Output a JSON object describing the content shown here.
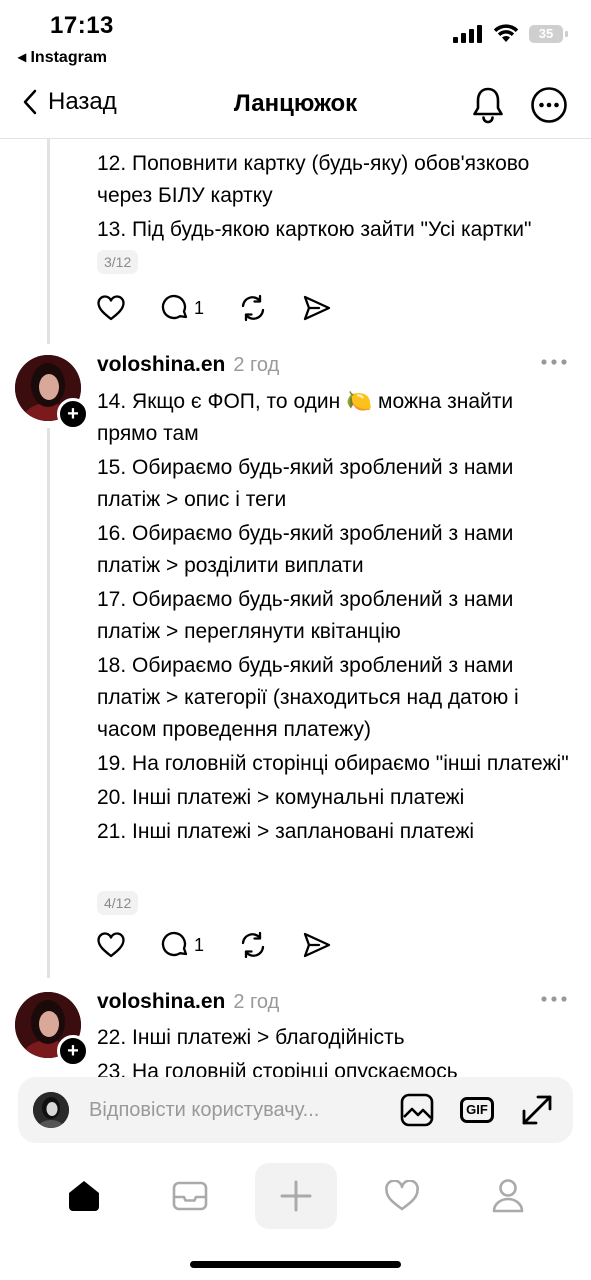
{
  "status_bar": {
    "time": "17:13",
    "back_app": "◂ Instagram",
    "battery": "35"
  },
  "nav": {
    "back_label": "Назад",
    "title": "Ланцюжок"
  },
  "posts": [
    {
      "lines": [
        "12. Поповнити картку (будь-яку) обов'язково через БІЛУ картку",
        "13. Під будь-якою карткою зайти \"Усі картки\""
      ],
      "page_badge": "3/12",
      "reply_count": "1"
    },
    {
      "username": "voloshina.en",
      "time": "2 год",
      "lines": [
        "14. Якщо є ФОП, то один 🍋 можна знайти прямо там",
        "15. Обираємо будь-який зроблений з нами платіж > опис і теги",
        "16. Обираємо будь-який зроблений з нами платіж > розділити виплати",
        "17. Обираємо будь-який зроблений з нами платіж > переглянути квітанцію",
        "18. Обираємо будь-який зроблений з нами платіж > категорії (знаходиться над датою і часом проведення платежу)",
        "19. На головній сторінці обираємо \"інші платежі\"",
        "20. Інші платежі > комунальні платежі",
        "21. Інші платежі > заплановані платежі"
      ],
      "page_badge": "4/12",
      "reply_count": "1"
    },
    {
      "username": "voloshina.en",
      "time": "2 год",
      "lines": [
        "22. Інші платежі > благодійність",
        "23. На головній сторінці опускаємось"
      ]
    }
  ],
  "reply_bar": {
    "placeholder": "Відповісти користувачу..."
  },
  "tabs": [
    "home-icon",
    "inbox-icon",
    "create-icon",
    "activity-icon",
    "profile-icon"
  ],
  "colors": {
    "avatar_bg": "#3b0d0f",
    "muted": "#999999",
    "divider": "#e3e3e3"
  }
}
